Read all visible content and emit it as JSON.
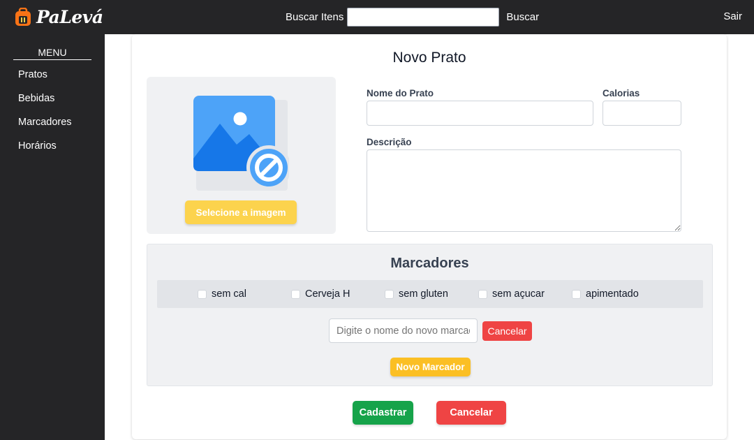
{
  "app": {
    "name": "PaLevá"
  },
  "header": {
    "search_label": "Buscar Itens",
    "search_value": "",
    "search_button": "Buscar",
    "logout": "Sair"
  },
  "sidebar": {
    "title": "MENU",
    "items": [
      {
        "label": "Pratos"
      },
      {
        "label": "Bebidas"
      },
      {
        "label": "Marcadores"
      },
      {
        "label": "Horários"
      }
    ]
  },
  "form": {
    "title": "Novo Prato",
    "select_image_button": "Selecione a imagem",
    "name_label": "Nome do Prato",
    "name_value": "",
    "calories_label": "Calorias",
    "calories_value": "",
    "description_label": "Descrição",
    "description_value": "",
    "submit_button": "Cadastrar",
    "cancel_button": "Cancelar"
  },
  "tags": {
    "title": "Marcadores",
    "items": [
      {
        "label": "sem cal",
        "checked": false
      },
      {
        "label": "Cerveja H",
        "checked": false
      },
      {
        "label": "sem gluten",
        "checked": false
      },
      {
        "label": "sem açucar",
        "checked": false
      },
      {
        "label": "apimentado",
        "checked": false
      }
    ],
    "new_tag_placeholder": "Digite o nome do novo marcador",
    "cancel_button": "Cancelar",
    "new_tag_button": "Novo Marcador"
  },
  "colors": {
    "topbar": "#252527",
    "accent_yellow": "#fbbf24",
    "success_green": "#16a34a",
    "danger_red": "#ef4444",
    "panel_gray": "#f0f1f3"
  },
  "icons": {
    "logo": "backpack-logo-icon",
    "image_placeholder": "image-unavailable-icon"
  }
}
